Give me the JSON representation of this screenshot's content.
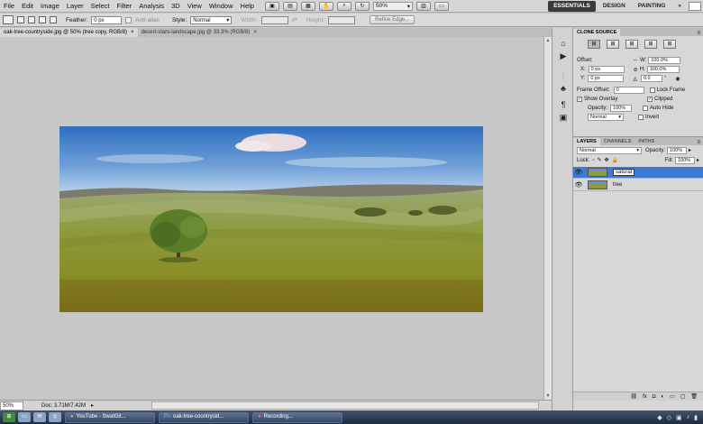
{
  "menu": [
    "File",
    "Edit",
    "Image",
    "Layer",
    "Select",
    "Filter",
    "Analysis",
    "3D",
    "View",
    "Window",
    "Help"
  ],
  "menubar_extras": {
    "zoom": "50%"
  },
  "workspaces": [
    "ESSENTIALS",
    "DESIGN",
    "PAINTING",
    "»"
  ],
  "options": {
    "feather_label": "Feather:",
    "feather_value": "0 px",
    "antialias_label": "Anti-alias",
    "style_label": "Style:",
    "style_value": "Normal",
    "width_label": "Width:",
    "height_label": "Height:",
    "refine_edge": "Refine Edge..."
  },
  "doc_tabs": [
    {
      "label": "oak-tree-countryside.jpg @ 50% (tree copy, RGB/8)",
      "close": "×"
    },
    {
      "label": "desert-stars-landscape.jpg @ 33.3% (RGB/8)",
      "close": "×"
    }
  ],
  "status": {
    "zoom": "50%",
    "doc": "Doc: 3.71M/7.42M"
  },
  "clone_source": {
    "tabs": [
      "CLONE SOURCE"
    ],
    "offset_label": "Offset:",
    "x_label": "X:",
    "x_value": "0 px",
    "y_label": "Y:",
    "y_value": "0 px",
    "w_label": "W:",
    "w_value": "100.0%",
    "h_label": "H:",
    "h_value": "100.0%",
    "angle_value": "0.0",
    "angle_unit": "°",
    "frame_offset_label": "Frame Offset:",
    "frame_offset_value": "0",
    "lock_frame": "Lock Frame",
    "show_overlay": "Show Overlay",
    "clipped": "Clipped",
    "opacity_label": "Opacity:",
    "opacity_value": "100%",
    "auto_hide": "Auto Hide",
    "blend": "Normal",
    "invert": "Invert"
  },
  "layers": {
    "tabs": [
      "LAYERS",
      "CHANNELS",
      "PATHS"
    ],
    "blend_mode": "Normal",
    "opacity_label": "Opacity:",
    "opacity_value": "100%",
    "lock_label": "Lock:",
    "fill_label": "Fill:",
    "fill_value": "100%",
    "items": [
      {
        "name": "saturat",
        "selected": true
      },
      {
        "name": "tree",
        "selected": false
      }
    ]
  },
  "taskbar": {
    "buttons": [
      "YouTube - SwatGit...",
      "oak-tree-countrysid...",
      "Recording..."
    ]
  },
  "colors": {
    "accent": "#3e7ad4",
    "workspace_active": "#3a3a3a"
  }
}
